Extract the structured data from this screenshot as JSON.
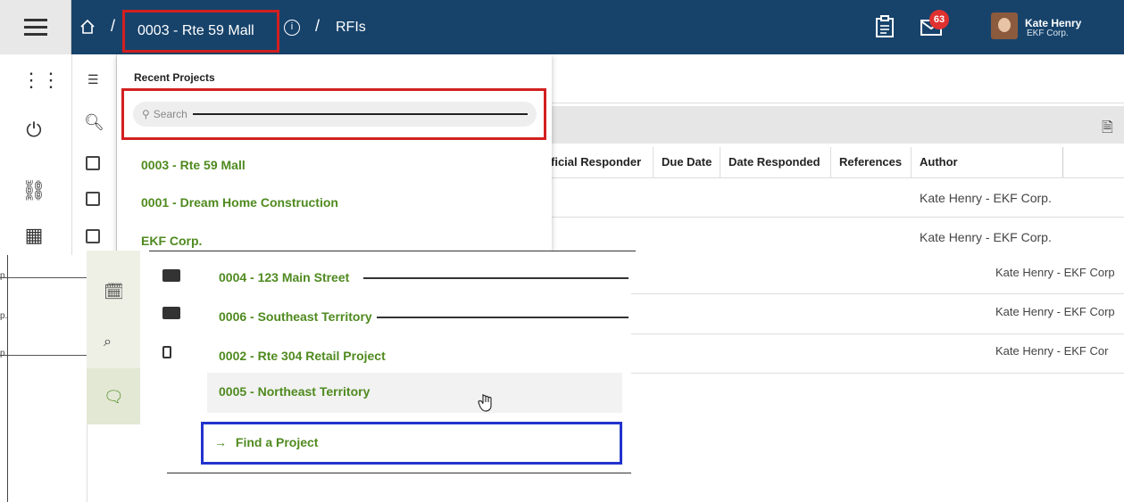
{
  "breadcrumb": {
    "project": "0003 - Rte 59 Mall",
    "page": "RFIs",
    "separator": "/"
  },
  "header": {
    "notification_count": "63",
    "user_name": "Kate Henry",
    "user_org": "EKF Corp."
  },
  "dropdown": {
    "title": "Recent Projects",
    "search_placeholder": "Search",
    "items": [
      "0003 - Rte 59 Mall",
      "0001 - Dream Home Construction",
      "EKF Corp.",
      "0004 - 123 Main Street",
      "0006 - Southeast Territory",
      "0002 - Rte 304 Retail Project",
      "0005 - Northeast Territory"
    ],
    "find_label": "Find a Project",
    "find_arrow": "→"
  },
  "table": {
    "columns": [
      "ficial Responder",
      "Due Date",
      "Date Responded",
      "References",
      "Author"
    ],
    "authors": [
      "Kate Henry - EKF Corp.",
      "Kate Henry - EKF Corp.",
      "Kate Henry - EKF Corp",
      "Kate Henry - EKF Corp",
      "Kate Henry - EKF Cor"
    ],
    "row_stubs": [
      "p.",
      "p.",
      "p."
    ]
  },
  "colors": {
    "header_bg": "#17436b",
    "accent_green": "#4f8a1f",
    "highlight_red": "#d22020",
    "highlight_blue": "#2233cc",
    "badge_red": "#e03131"
  }
}
